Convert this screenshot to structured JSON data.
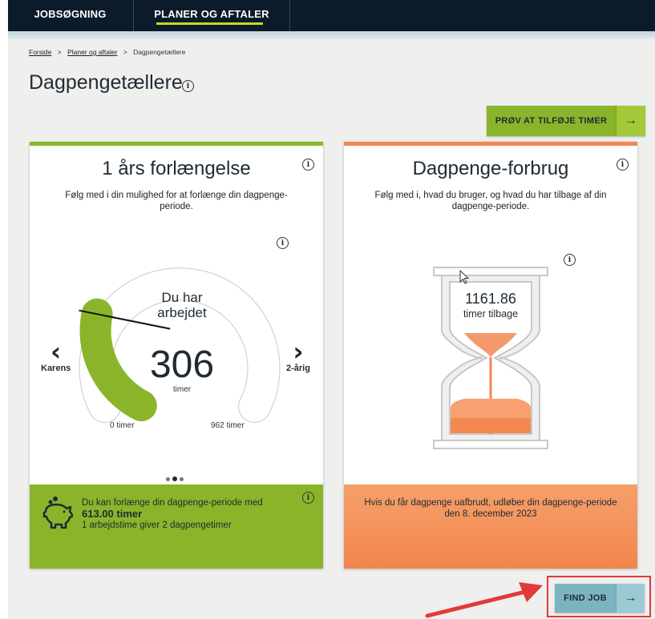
{
  "nav": {
    "tabs": [
      {
        "label": "JOBSØGNING"
      },
      {
        "label": "PLANER OG AFTALER",
        "active": true
      }
    ]
  },
  "breadcrumb": {
    "items": [
      "Forside",
      "Planer og aftaler",
      "Dagpengetællere"
    ],
    "separator": ">"
  },
  "page": {
    "title": "Dagpengetællere",
    "info_glyph": "i"
  },
  "actions": {
    "add_hours_label": "PRØV AT TILFØJE TIMER",
    "find_job_label": "FIND JOB",
    "arrow_glyph": "→"
  },
  "extension_card": {
    "title": "1 års forlængelse",
    "description": "Følg med i din mulighed for at forlænge din dagpenge-periode.",
    "gauge": {
      "text": "Du har arbejdet",
      "value": "306",
      "unit": "timer",
      "min_label": "0 timer",
      "max_label": "962 timer",
      "fraction": 0.318
    },
    "prev_label": "Karens",
    "next_label": "2-årig",
    "prev_glyph": "‹",
    "next_glyph": "›",
    "pager": {
      "count": 3,
      "active_index": 1
    },
    "footer": {
      "line1": "Du kan forlænge din dagpenge-periode med",
      "line2": "613.00 timer",
      "line3": "1 arbejdstime giver 2 dagpengetimer"
    }
  },
  "usage_card": {
    "title": "Dagpenge-forbrug",
    "description": "Følg med i, hvad du bruger, og hvad du har tilbage af din dagpenge-periode.",
    "hourglass": {
      "value": "1161.86",
      "label": "timer tilbage"
    },
    "footer": "Hvis du får dagpenge uafbrudt, udløber din dagpenge-periode den 8. december 2023"
  },
  "colors": {
    "navy": "#0c1b2a",
    "green": "#8ab52a",
    "orange": "#f28752",
    "teal": "#7ab4c1",
    "highlight_red": "#e13a3a"
  },
  "icons": [
    "info-icon",
    "chevron-left-icon",
    "chevron-right-icon",
    "piggy-bank-icon",
    "hourglass-icon",
    "arrow-right-icon",
    "mouse-cursor-icon",
    "red-annotation-arrow-icon"
  ]
}
